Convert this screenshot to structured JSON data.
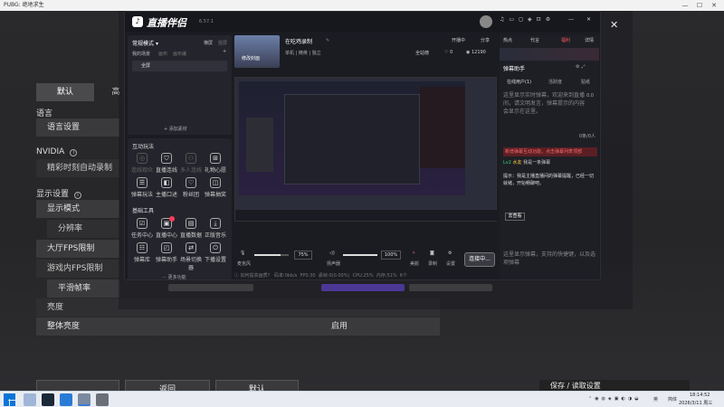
{
  "bg_window": {
    "title": "PUBG: 绝地求生",
    "tabs": [
      "默认",
      "高"
    ],
    "sections": {
      "language": {
        "heading": "语言",
        "row": "语言设置"
      },
      "nvidia": {
        "heading": "NVIDIA",
        "row": "精彩时刻自动录制"
      },
      "display": {
        "heading": "显示设置",
        "rows": [
          "显示模式",
          "分辨率",
          "大厅FPS限制",
          "游戏内FPS限制",
          "平滑帧率",
          "亮度",
          "整体亮度"
        ],
        "brightness_value": "启用"
      }
    },
    "bottom_buttons": {
      "back": "返回",
      "default": "默认"
    },
    "save_bar": "保存 / 读取设置"
  },
  "app": {
    "logo": "直播伴侣",
    "version": "6.57.1",
    "window_controls": [
      "—",
      "✕"
    ],
    "top_icons": [
      "headset",
      "monitor",
      "chat",
      "gift",
      "cast",
      "settings",
      "minimize"
    ],
    "mode_select": "常规模式",
    "scene_actions": [
      "横屏",
      "竖屏"
    ],
    "scene_label": "我的场景",
    "scene_tabs": [
      "画布",
      "画布编"
    ],
    "source_item": "全屏",
    "add_material": "添加素材",
    "interaction": {
      "title": "互动玩法",
      "tools": [
        {
          "label": "连线观众",
          "dim": true
        },
        {
          "label": "直播连线",
          "dim": false
        },
        {
          "label": "多人连线",
          "dim": true
        },
        {
          "label": "礼物心愿",
          "dim": false
        },
        {
          "label": "弹幕玩法",
          "dim": false
        },
        {
          "label": "主播口述",
          "dim": false
        },
        {
          "label": "粉丝团",
          "dim": false
        },
        {
          "label": "弹幕抽奖",
          "dim": false
        }
      ]
    },
    "basic_tools": {
      "title": "基础工具",
      "tools": [
        {
          "label": "任务中心"
        },
        {
          "label": "直播中心"
        },
        {
          "label": "直播数据"
        },
        {
          "label": "正版音乐"
        },
        {
          "label": "弹幕库"
        },
        {
          "label": "弹幕助手"
        },
        {
          "label": "场景切换器"
        },
        {
          "label": "下播设置"
        }
      ],
      "more": "更多功能"
    },
    "stream": {
      "title": "在吃鸡录制",
      "subtitle": "待定",
      "status": "修改封面",
      "tags": [
        "单机",
        "精英",
        "独立"
      ],
      "links": [
        "开播中",
        "分享"
      ],
      "stats_label": "全站榜",
      "likes": "0",
      "viewers": "12190"
    },
    "audio": {
      "mic_label": "麦克风",
      "mic_level": "75%",
      "speaker_label": "扬声器",
      "speaker_level": "100%",
      "mic_fraction": 0.75,
      "speaker_fraction": 1.0
    },
    "controls": {
      "beauty": "美颜",
      "record": "录制",
      "settings": "设置",
      "live_button": "连接中..."
    },
    "status_bar": {
      "hint": "如何提高画质?",
      "upload": "码率:0kb/s",
      "fps": "FPS:30",
      "drop": "丢帧:0(0.00%)",
      "cpu": "CPU:25%",
      "mem": "内存:51%",
      "extra": "6个"
    },
    "right_panel": {
      "tabs": [
        "热点",
        "代言",
        "福利"
      ],
      "right_link": "详情",
      "helper_title": "弹幕助手",
      "sub_tabs": [
        "在线用户(1)",
        "活跃度",
        "贴纸"
      ],
      "msg_placeholder": "这里显示实时弹幕，欢迎来到直播间，请文明发言，弹幕提示的内容会显示在这里。",
      "count": "0.0",
      "count2": "0条/0人",
      "alert": "新增弹幕互动功能，点击弹幕列表顶部",
      "user_line": "我是一条弹幕",
      "user_badge": "Lv2",
      "notice": "提示：我是主播直播间的弹幕提醒，已经一切就绪，开始畅聊吧。",
      "tip_link": "去查看",
      "bottom_hint": "这里显示弹幕，支持的快捷键，以及选项弹幕"
    }
  },
  "taskbar": {
    "time": "18:14:52",
    "date": "2026/3/11 周三",
    "lang": "英",
    "ime": "简体"
  }
}
